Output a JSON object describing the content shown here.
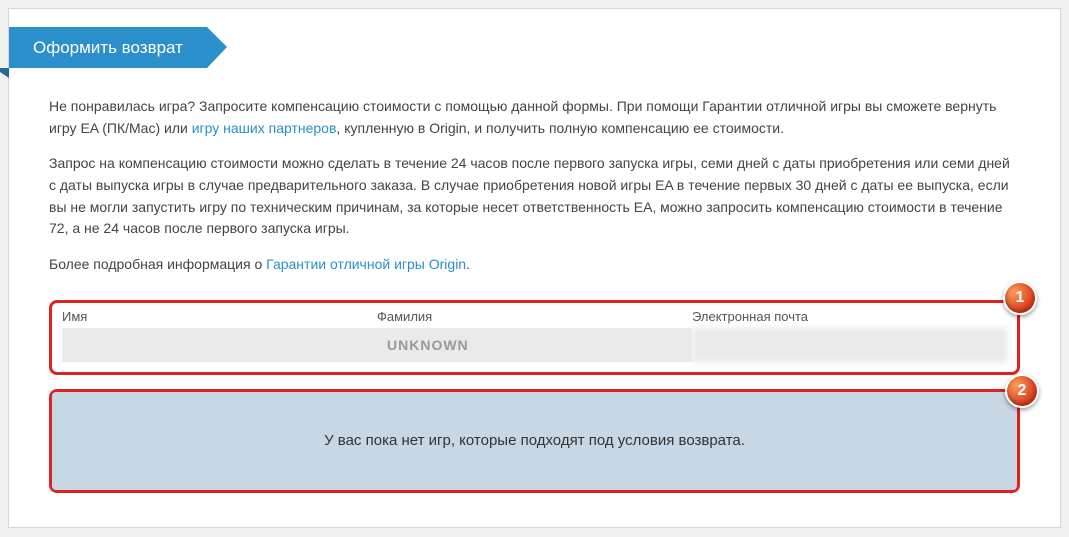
{
  "ribbon": {
    "title": "Оформить возврат"
  },
  "paragraphs": {
    "p1_a": "Не понравилась игра? Запросите компенсацию стоимости с помощью данной формы. При помощи Гарантии отличной игры вы сможете вернуть игру EA (ПК/Mac) или ",
    "p1_link": "игру наших партнеров",
    "p1_b": ", купленную в Origin, и получить полную компенсацию ее стоимости.",
    "p2": "Запрос на компенсацию стоимости можно сделать в течение 24 часов после первого запуска игры, семи дней с даты приобретения или семи дней с даты выпуска игры в случае предварительного заказа. В случае приобретения новой игры EA в течение первых 30 дней с даты ее выпуска, если вы не могли запустить игру по техническим причинам, за которые несет ответственность EA, можно запросить компенсацию стоимости в течение 72, а не 24 часов после первого запуска игры.",
    "p3_a": "Более подробная информация о ",
    "p3_link": "Гарантии отличной игры Origin",
    "p3_b": "."
  },
  "fields": {
    "name": {
      "label": "Имя",
      "value": ""
    },
    "surname": {
      "label": "Фамилия",
      "value": "UNKNOWN"
    },
    "email": {
      "label": "Электронная почта",
      "value": ""
    }
  },
  "notice": {
    "text": "У вас пока нет игр, которые подходят под условия возврата."
  },
  "markers": {
    "m1": "1",
    "m2": "2"
  }
}
